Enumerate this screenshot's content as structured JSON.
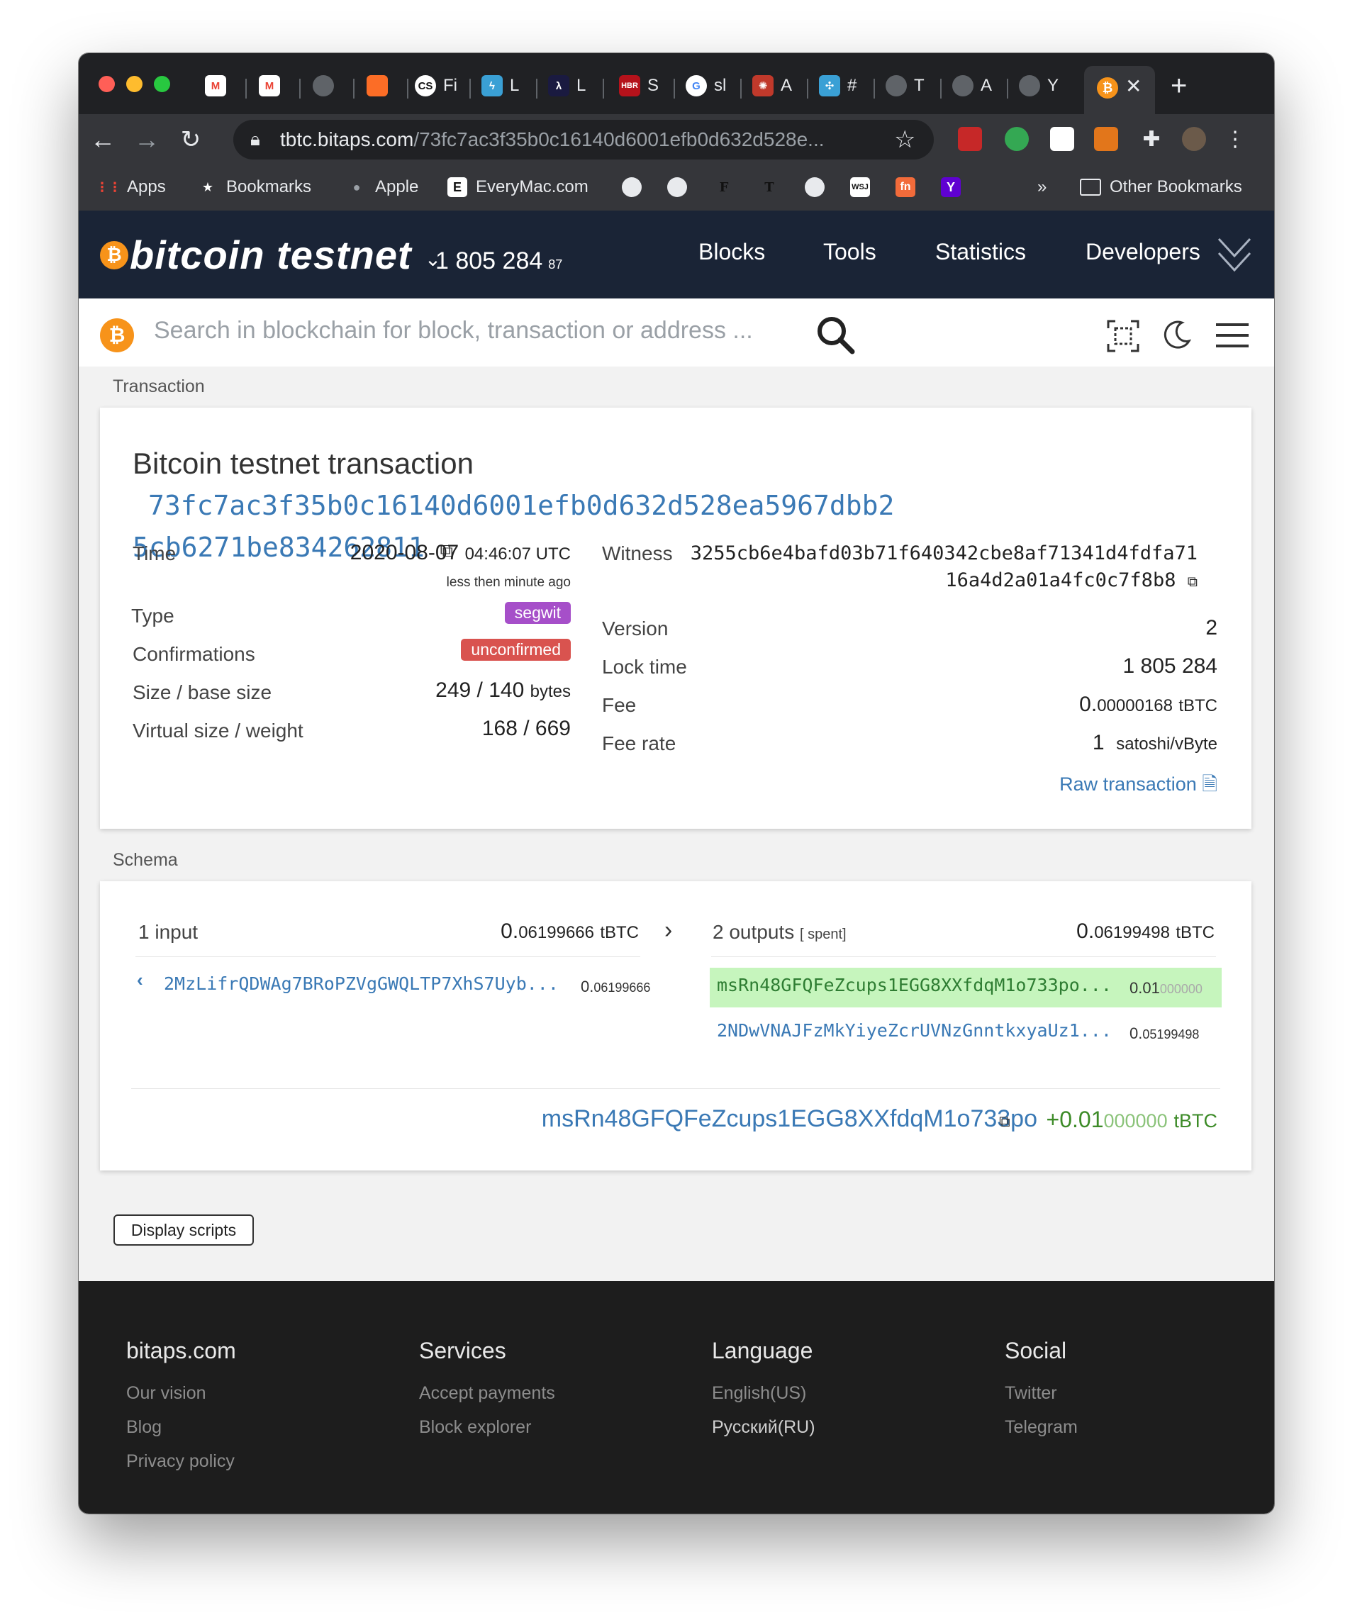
{
  "browser": {
    "tabs": [
      {
        "label": "",
        "icon": "gmail-icon",
        "color": "#ea4335"
      },
      {
        "label": "",
        "icon": "gmail-icon",
        "color": "#ea4335"
      },
      {
        "label": "",
        "icon": "globe-icon",
        "color": "#5f6368"
      },
      {
        "label": "",
        "icon": "gitlab-icon",
        "color": "#fc6d26"
      },
      {
        "label": "Fi",
        "icon": "cs-icon",
        "color": "#111111"
      },
      {
        "label": "L",
        "icon": "lightning-icon",
        "color": "#3aa0d5"
      },
      {
        "label": "L",
        "icon": "lambda-icon",
        "color": "#1a1a40"
      },
      {
        "label": "S",
        "icon": "hbr-icon",
        "color": "#b5121b"
      },
      {
        "label": "sl",
        "icon": "google-icon",
        "color": "#ffffff"
      },
      {
        "label": "A",
        "icon": "openai-icon",
        "color": "#c0392b"
      },
      {
        "label": "#",
        "icon": "knot-icon",
        "color": "#3aa0d5"
      },
      {
        "label": "T",
        "icon": "globe-icon",
        "color": "#5f6368"
      },
      {
        "label": "A",
        "icon": "globe-icon",
        "color": "#5f6368"
      },
      {
        "label": "Y",
        "icon": "globe-icon",
        "color": "#5f6368"
      }
    ],
    "url_host": "tbtc.bitaps.com",
    "url_path": "/73fc7ac3f35b0c16140d6001efb0d632d528e...",
    "bookmarks": {
      "apps": "Apps",
      "bookmarks": "Bookmarks",
      "apple": "Apple",
      "everymac": "EveryMac.com",
      "more": "»",
      "other": "Other Bookmarks"
    }
  },
  "site": {
    "brand": "bitcoin testnet",
    "block_height": "1 805 284",
    "block_height_sub": "87",
    "nav": [
      "Blocks",
      "Tools",
      "Statistics",
      "Developers"
    ],
    "search_placeholder": "Search in blockchain for block, transaction or address ..."
  },
  "transaction": {
    "section_label": "Transaction",
    "heading": "Bitcoin testnet transaction",
    "txid_line1": "73fc7ac3f35b0c16140d6001efb0d632d528ea5967dbb2",
    "txid_line2": "5cb6271be834262811",
    "time_label": "Time",
    "time_date": "2020-08-07",
    "time_clock": "04:46:07 UTC",
    "time_ago": "less then minute ago",
    "type_label": "Type",
    "type_value": "segwit",
    "confirmations_label": "Confirmations",
    "confirmations_value": "unconfirmed",
    "size_label": "Size / base size",
    "size_value": "249 / 140",
    "size_unit": "bytes",
    "vsize_label": "Virtual size / weight",
    "vsize_value": "168 / 669",
    "witness_label": "Witness",
    "witness_line1": "3255cb6e4bafd03b71f640342cbe8af71341d4fdfa71",
    "witness_line2": "16a4d2a01a4fc0c7f8b8",
    "version_label": "Version",
    "version_value": "2",
    "locktime_label": "Lock time",
    "locktime_value": "1 805 284",
    "fee_label": "Fee",
    "fee_big": "0.",
    "fee_small": "00000168",
    "fee_unit": "tBTC",
    "feerate_label": "Fee rate",
    "feerate_value": "1",
    "feerate_unit": "satoshi/vByte",
    "raw_link": "Raw transaction"
  },
  "schema": {
    "section_label": "Schema",
    "inputs_label": "1 input",
    "inputs_total_big": "0.",
    "inputs_total_small": "06199666",
    "inputs_unit": "tBTC",
    "outputs_label": "2 outputs",
    "outputs_spent": "[ spent]",
    "outputs_total_big": "0.",
    "outputs_total_small": "06199498",
    "outputs_unit": "tBTC",
    "input_rows": [
      {
        "address": "2MzLifrQDWAg7BRoPZVgGWQLTP7XhS7Uyb...",
        "amount_big": "0.",
        "amount_small": "06199666"
      }
    ],
    "output_rows": [
      {
        "address": "msRn48GFQFeZcups1EGG8XXfdqM1o733po...",
        "amount_big": "0.01",
        "amount_dim": "000000"
      },
      {
        "address": "2NDwVNAJFzMkYiyeZcrUVNzGnntkxyaUz1...",
        "amount_big": "0.",
        "amount_dim": "05199498"
      }
    ],
    "focus_address": "msRn48GFQFeZcups1EGG8XXfdqM1o733po",
    "focus_amount_big": "+0.01",
    "focus_amount_dim": "000000",
    "focus_unit": "tBTC"
  },
  "display_scripts": "Display scripts",
  "footer": {
    "cols": [
      {
        "title": "bitaps.com",
        "links": [
          "Our vision",
          "Blog",
          "Privacy policy"
        ]
      },
      {
        "title": "Services",
        "links": [
          "Accept payments",
          "Block explorer"
        ]
      },
      {
        "title": "Language",
        "links": [
          "English(US)",
          "Русский(RU)"
        ]
      },
      {
        "title": "Social",
        "links": [
          "Twitter",
          "Telegram"
        ]
      }
    ]
  },
  "colors": {
    "header_bg": "#1a2436",
    "bitcoin_orange": "#f7931a",
    "segwit_badge": "#a64fc9",
    "unconfirmed_badge": "#d9534f",
    "link_blue": "#3a79b5",
    "output_highlight": "#c6f5bd",
    "positive_green": "#3d8b28"
  }
}
